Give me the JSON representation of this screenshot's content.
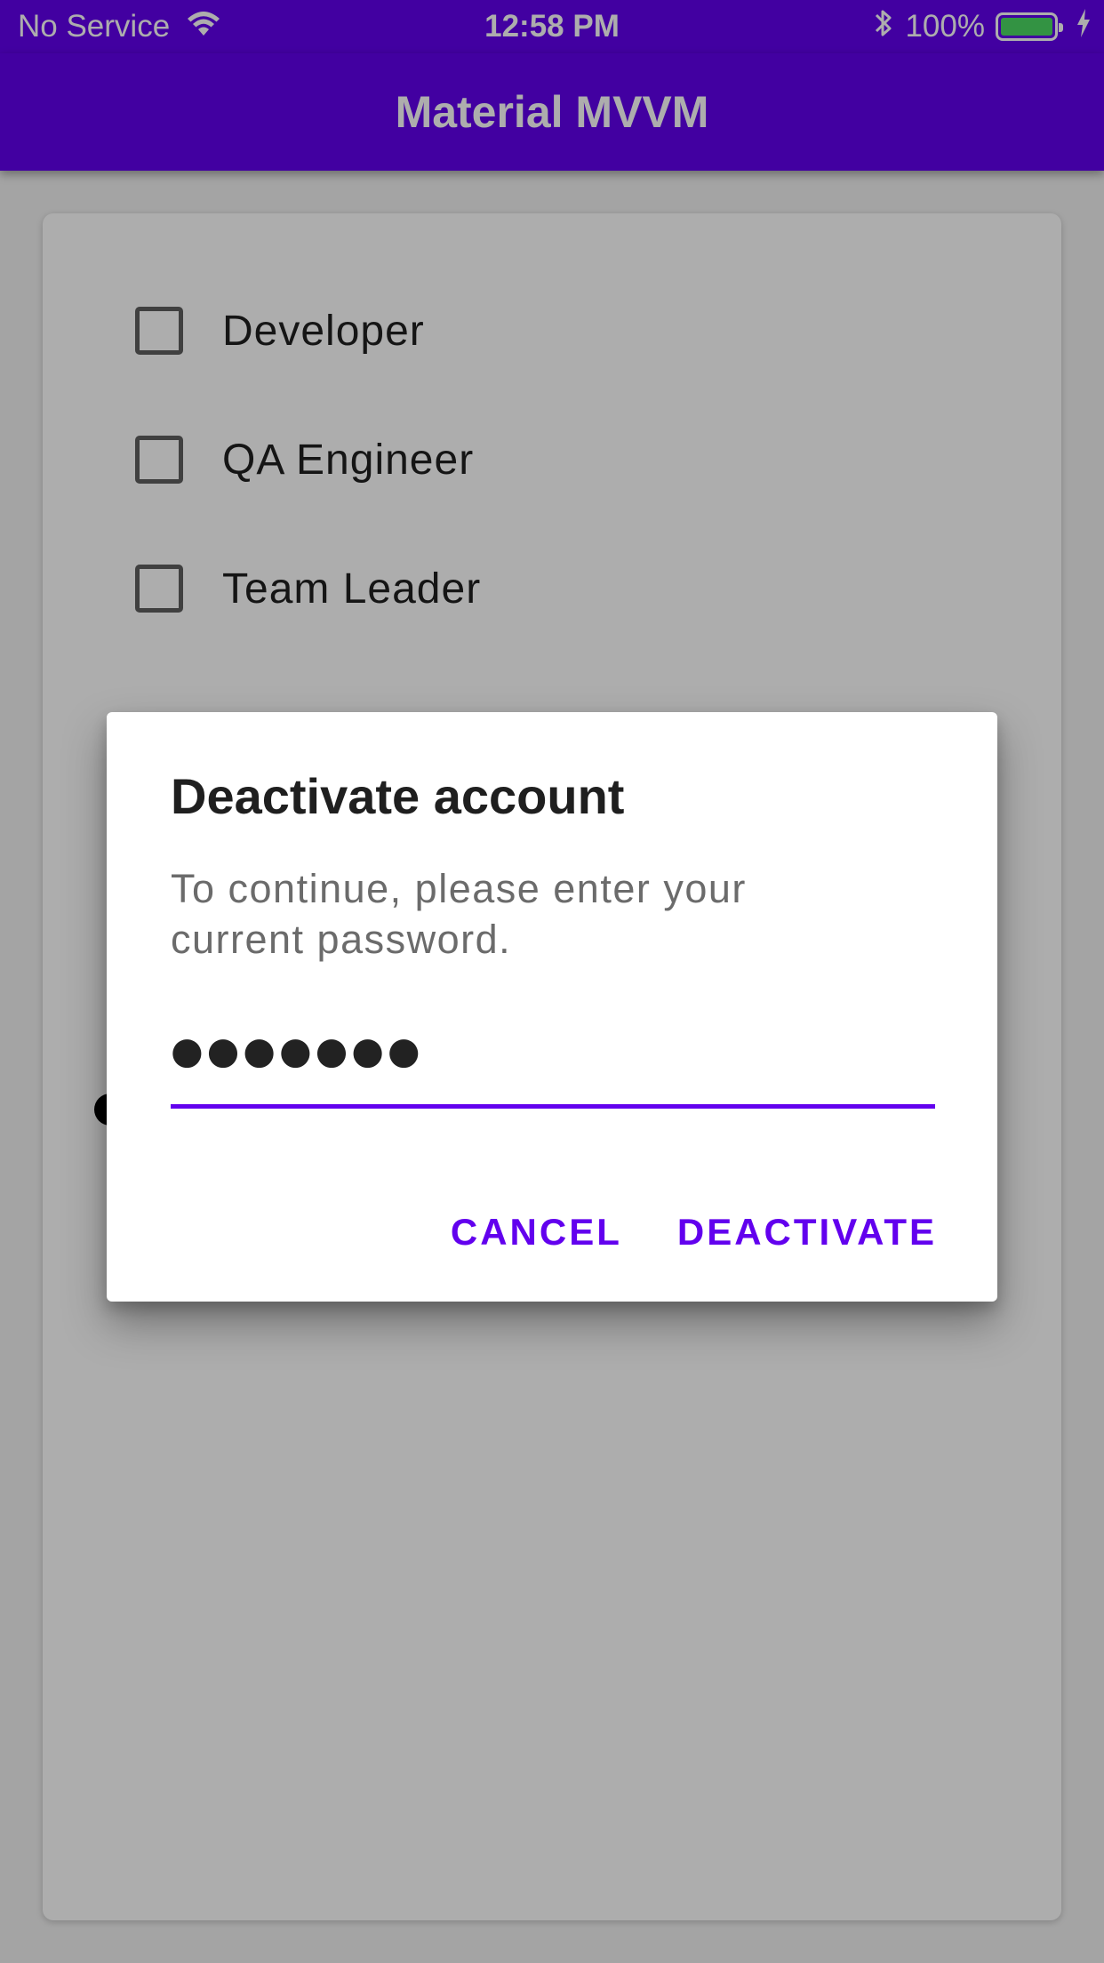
{
  "status_bar": {
    "carrier": "No Service",
    "time": "12:58 PM",
    "battery_text": "100%",
    "battery_level": 1.0
  },
  "app_bar": {
    "title": "Material MVVM"
  },
  "roles": [
    {
      "label": "Developer",
      "checked": false
    },
    {
      "label": "QA Engineer",
      "checked": false
    },
    {
      "label": "Team Leader",
      "checked": false
    }
  ],
  "dialog": {
    "title": "Deactivate account",
    "message": "To continue, please enter your current password.",
    "password_value": "●●●●●●●",
    "cancel_label": "CANCEL",
    "confirm_label": "DEACTIVATE"
  },
  "colors": {
    "primary": "#6200ee",
    "scrim": "rgba(0,0,0,0.32)",
    "battery": "#4cd964"
  },
  "icons": [
    "wifi-icon",
    "bluetooth-icon",
    "battery-icon",
    "charging-icon"
  ]
}
